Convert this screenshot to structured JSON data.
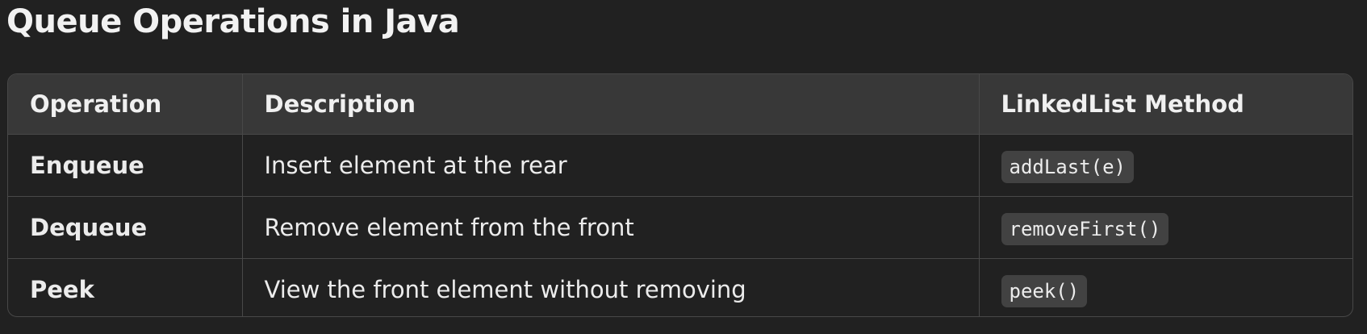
{
  "title": "Queue Operations in Java",
  "table": {
    "headers": [
      "Operation",
      "Description",
      "LinkedList Method"
    ],
    "rows": [
      {
        "operation": "Enqueue",
        "description": "Insert element at the rear",
        "method": "addLast(e)"
      },
      {
        "operation": "Dequeue",
        "description": "Remove element from the front",
        "method": "removeFirst()"
      },
      {
        "operation": "Peek",
        "description": "View the front element without removing",
        "method": "peek()"
      }
    ]
  }
}
